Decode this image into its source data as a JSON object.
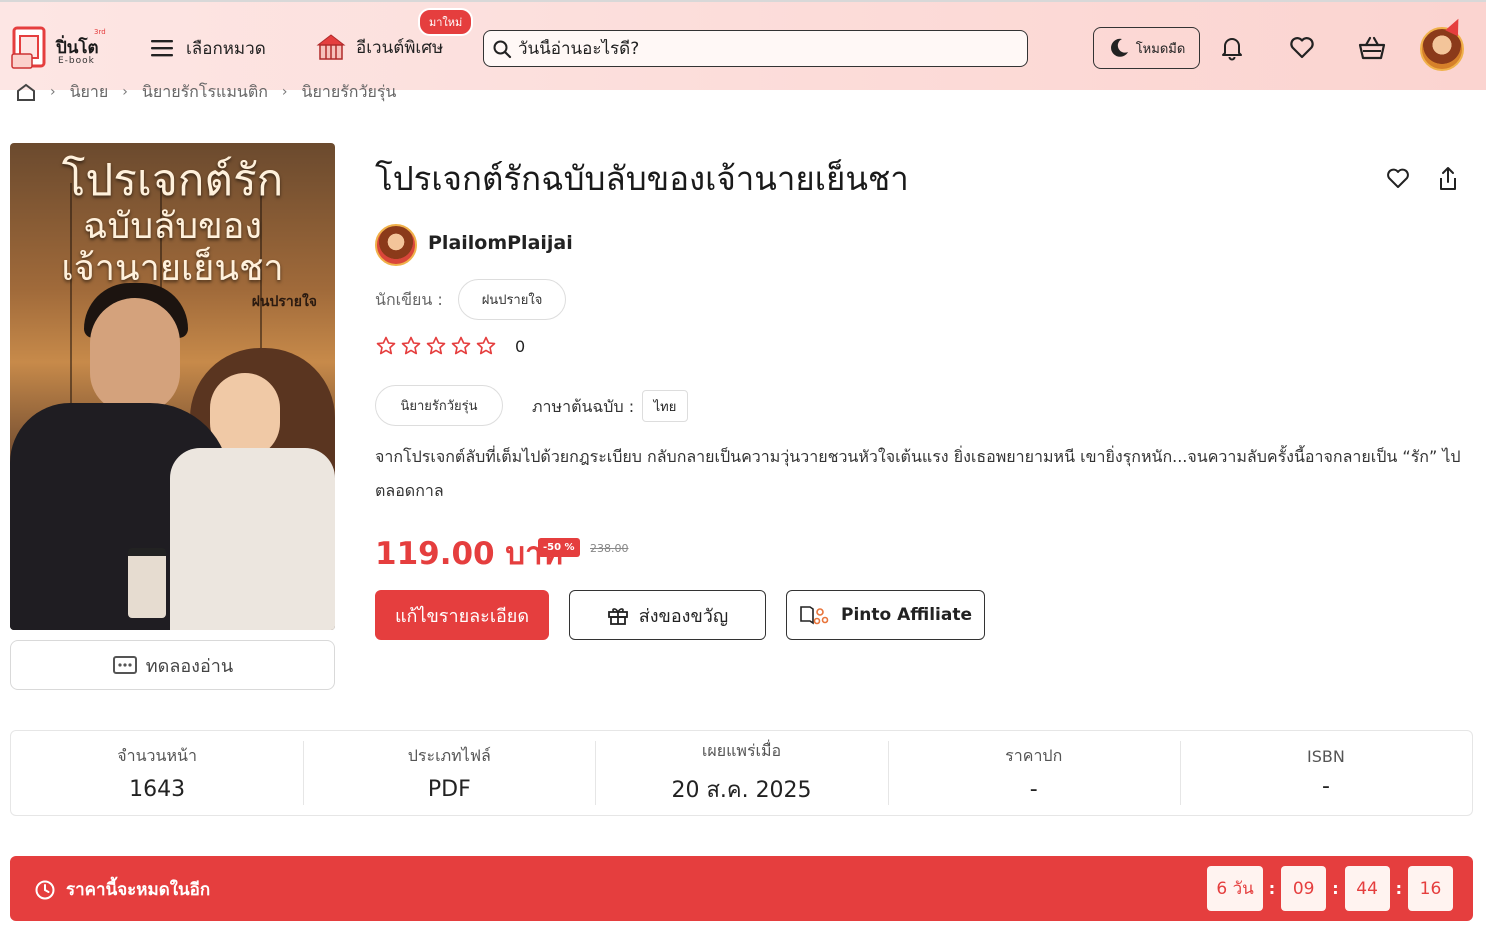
{
  "header": {
    "logo_text": "ปิ่นโต",
    "logo_sub": "E-book",
    "logo_sup": "3rd",
    "nav_categories": "เลือกหมวด",
    "nav_events": "อีเวนต์พิเศษ",
    "new_badge": "มาใหม่",
    "search_placeholder": "วันนี้อ่านอะไรดี?",
    "dark_mode": "โหมดมืด"
  },
  "breadcrumb": {
    "items": [
      "นิยาย",
      "นิยายรักโรแมนติก",
      "นิยายรักวัยรุ่น"
    ]
  },
  "cover": {
    "title_line1": "โปรเจกต์รัก",
    "title_line2": "ฉบับลับของ",
    "title_line3": "เจ้านายเย็นชา",
    "author": "ฝนปรายใจ"
  },
  "try_read": "ทดลองอ่าน",
  "book": {
    "title": "โปรเจกต์รักฉบับลับของเจ้านายเย็นชา",
    "publisher": "PlailomPlaijai",
    "writer_label": "นักเขียน :",
    "writer": "ฝนปรายใจ",
    "rating_count": "0",
    "genre": "นิยายรักวัยรุ่น",
    "lang_label": "ภาษาต้นฉบับ :",
    "lang": "ไทย",
    "description": "จากโปรเจกต์ลับที่เต็มไปด้วยกฎระเบียบ กลับกลายเป็นความวุ่นวายชวนหัวใจเต้นแรง ยิ่งเธอพยายามหนี เขายิ่งรุกหนัก...จนความลับครั้งนี้อาจกลายเป็น “รัก” ไปตลอดกาล",
    "price": "119.00 บาท",
    "discount": "-50 %",
    "old_price": "238.00",
    "rating_stars": 0
  },
  "actions": {
    "edit": "แก้ไขรายละเอียด",
    "gift": "ส่งของขวัญ",
    "affiliate": "Pinto Affiliate"
  },
  "info": [
    {
      "label": "จำนวนหน้า",
      "value": "1643"
    },
    {
      "label": "ประเภทไฟล์",
      "value": "PDF"
    },
    {
      "label": "เผยแพร่เมื่อ",
      "value": "20 ส.ค. 2025"
    },
    {
      "label": "ราคาปก",
      "value": "-"
    },
    {
      "label": "ISBN",
      "value": "-"
    }
  ],
  "countdown": {
    "label": "ราคานี้จะหมดในอีก",
    "days": "6 วัน",
    "hours": "09",
    "minutes": "44",
    "seconds": "16"
  },
  "colors": {
    "accent": "#e53e3e",
    "header_bg": "#fde6e4"
  }
}
